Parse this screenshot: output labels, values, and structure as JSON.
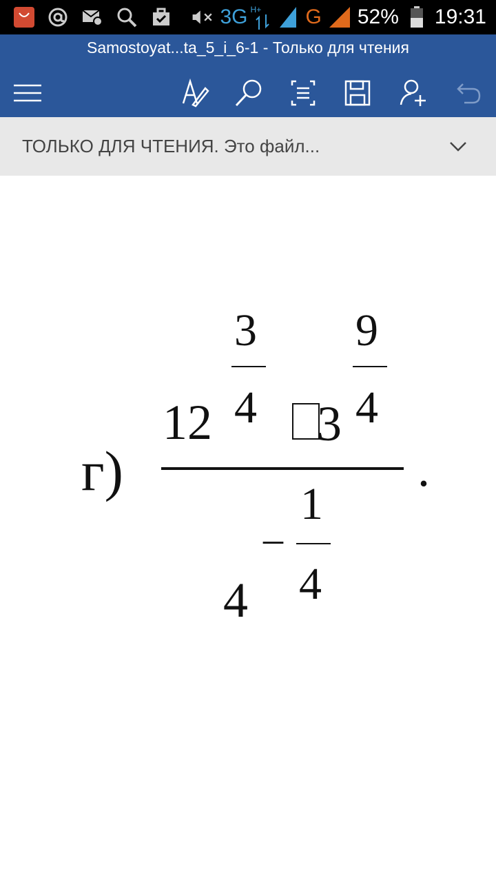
{
  "status_bar": {
    "icons": [
      "aliexpress-icon",
      "at-sign-icon",
      "mail-icon",
      "search-icon",
      "briefcase-icon"
    ],
    "network_3g": "3G",
    "network_hplus": "H+",
    "network_g": "G",
    "battery_percent": "52%",
    "time": "19:31"
  },
  "app_bar": {
    "title": "Samostoyat...ta_5_i_6-1 - Только для чтения",
    "toolbar_icons": [
      "menu-icon",
      "edit-pen-icon",
      "search-icon",
      "reading-view-icon",
      "save-icon",
      "share-person-icon",
      "undo-icon"
    ],
    "accent_color": "#2b579a"
  },
  "banner": {
    "text": "ТОЛЬКО ДЛЯ ЧТЕНИЯ. Это файл...",
    "background": "#e8e8e8"
  },
  "math": {
    "label": "г)",
    "base1": "12",
    "exp1_num": "3",
    "exp1_den": "4",
    "box_char": "□",
    "base2": "3",
    "exp2_num": "9",
    "exp2_den": "4",
    "den_base": "4",
    "den_exp_sign": "–",
    "den_exp_num": "1",
    "den_exp_den": "4",
    "end_dot": "."
  }
}
